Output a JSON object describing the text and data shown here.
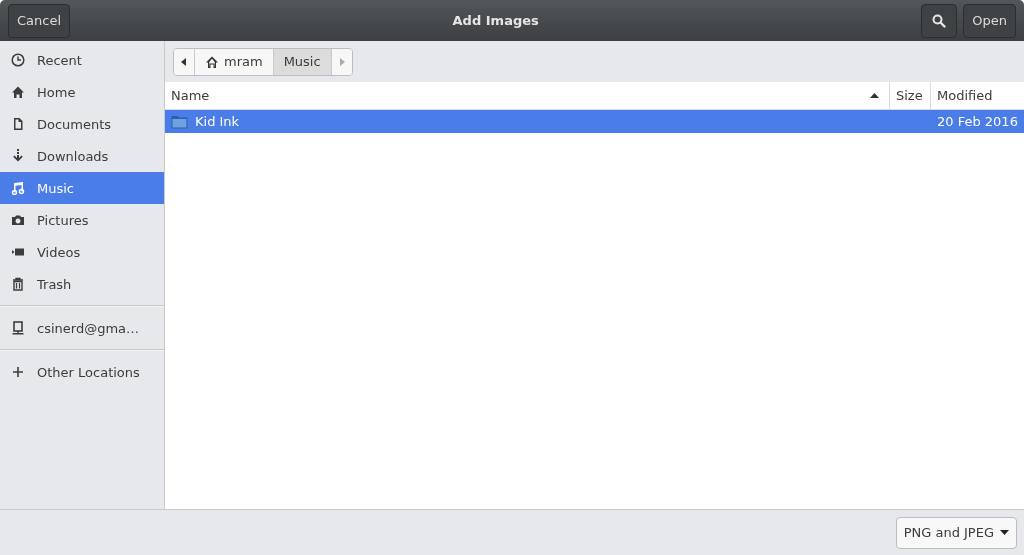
{
  "header": {
    "cancel": "Cancel",
    "title": "Add Images",
    "open": "Open"
  },
  "sidebar": {
    "sections": [
      [
        {
          "label": "Recent",
          "kind": "recent",
          "selected": false
        },
        {
          "label": "Home",
          "kind": "home",
          "selected": false
        },
        {
          "label": "Documents",
          "kind": "document",
          "selected": false
        },
        {
          "label": "Downloads",
          "kind": "download",
          "selected": false
        },
        {
          "label": "Music",
          "kind": "music",
          "selected": true
        },
        {
          "label": "Pictures",
          "kind": "camera",
          "selected": false
        },
        {
          "label": "Videos",
          "kind": "video",
          "selected": false
        },
        {
          "label": "Trash",
          "kind": "trash",
          "selected": false
        }
      ],
      [
        {
          "label": "csinerd@gma…",
          "kind": "drive",
          "selected": false
        }
      ],
      [
        {
          "label": "Other Locations",
          "kind": "plus",
          "selected": false
        }
      ]
    ]
  },
  "path_bar": [
    {
      "label": "mram",
      "kind": "home",
      "selected": false
    },
    {
      "label": "Music",
      "kind": "plain",
      "selected": true
    }
  ],
  "table": {
    "columns": [
      "Name",
      "Size",
      "Modified"
    ],
    "rows": [
      {
        "name": "Kid Ink",
        "size": "",
        "modified": "20 Feb 2016",
        "selected": true
      }
    ]
  },
  "filter": {
    "value": "PNG and JPEG"
  }
}
